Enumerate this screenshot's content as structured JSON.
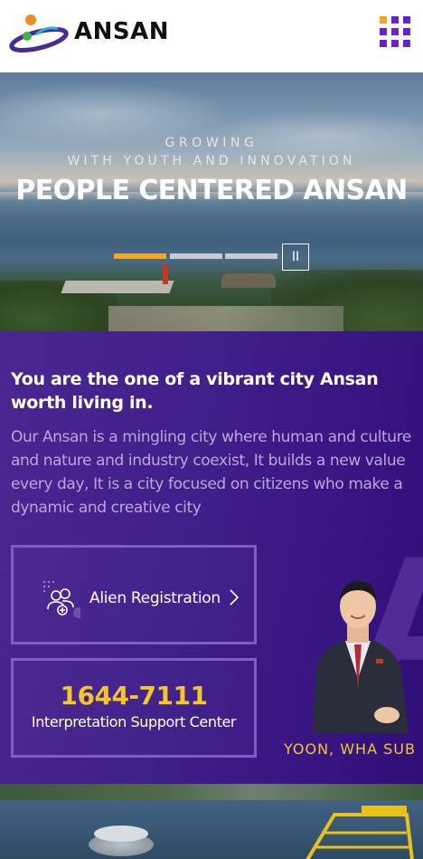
{
  "header": {
    "brand": "ANSAN",
    "logo_icon": "ansan-city-logo",
    "menu_icon": "grid-menu-icon",
    "menu_dot_colors": [
      "#f5a623",
      "#6a1fd1",
      "#6a1fd1",
      "#6a1fd1",
      "#6a1fd1",
      "#6a1fd1",
      "#6a1fd1",
      "#6a1fd1",
      "#6a1fd1"
    ]
  },
  "hero": {
    "line1": "GROWING",
    "line2": "WITH YOUTH AND INNOVATION",
    "title": "PEOPLE CENTERED ANSAN",
    "slides": [
      {
        "active": true,
        "color": "#f5a623"
      },
      {
        "active": false,
        "color": "#c8ccd2"
      },
      {
        "active": false,
        "color": "#c8ccd2"
      }
    ],
    "pause_label": "II"
  },
  "intro": {
    "title": "You are the one of a vibrant city Ansan worth living in.",
    "body": "Our Ansan is a mingling city where human and culture and nature and industry coexist, It builds a new value every day, It is a city focused on citizens who make a dynamic and creative city",
    "watermark": "A"
  },
  "alien_card": {
    "label": "Alien Registration",
    "icon": "people-add-icon",
    "chevron": "chevron-right-icon"
  },
  "phone_card": {
    "number": "1644-7111",
    "caption": "Interpretation Support Center"
  },
  "mayor": {
    "name": "YOON, WHA SUB"
  },
  "colors": {
    "accent_yellow": "#f2c62d",
    "accent_orange": "#f5a623",
    "purple": "#3f1f8a",
    "brand_purple": "#6a1fd1"
  }
}
